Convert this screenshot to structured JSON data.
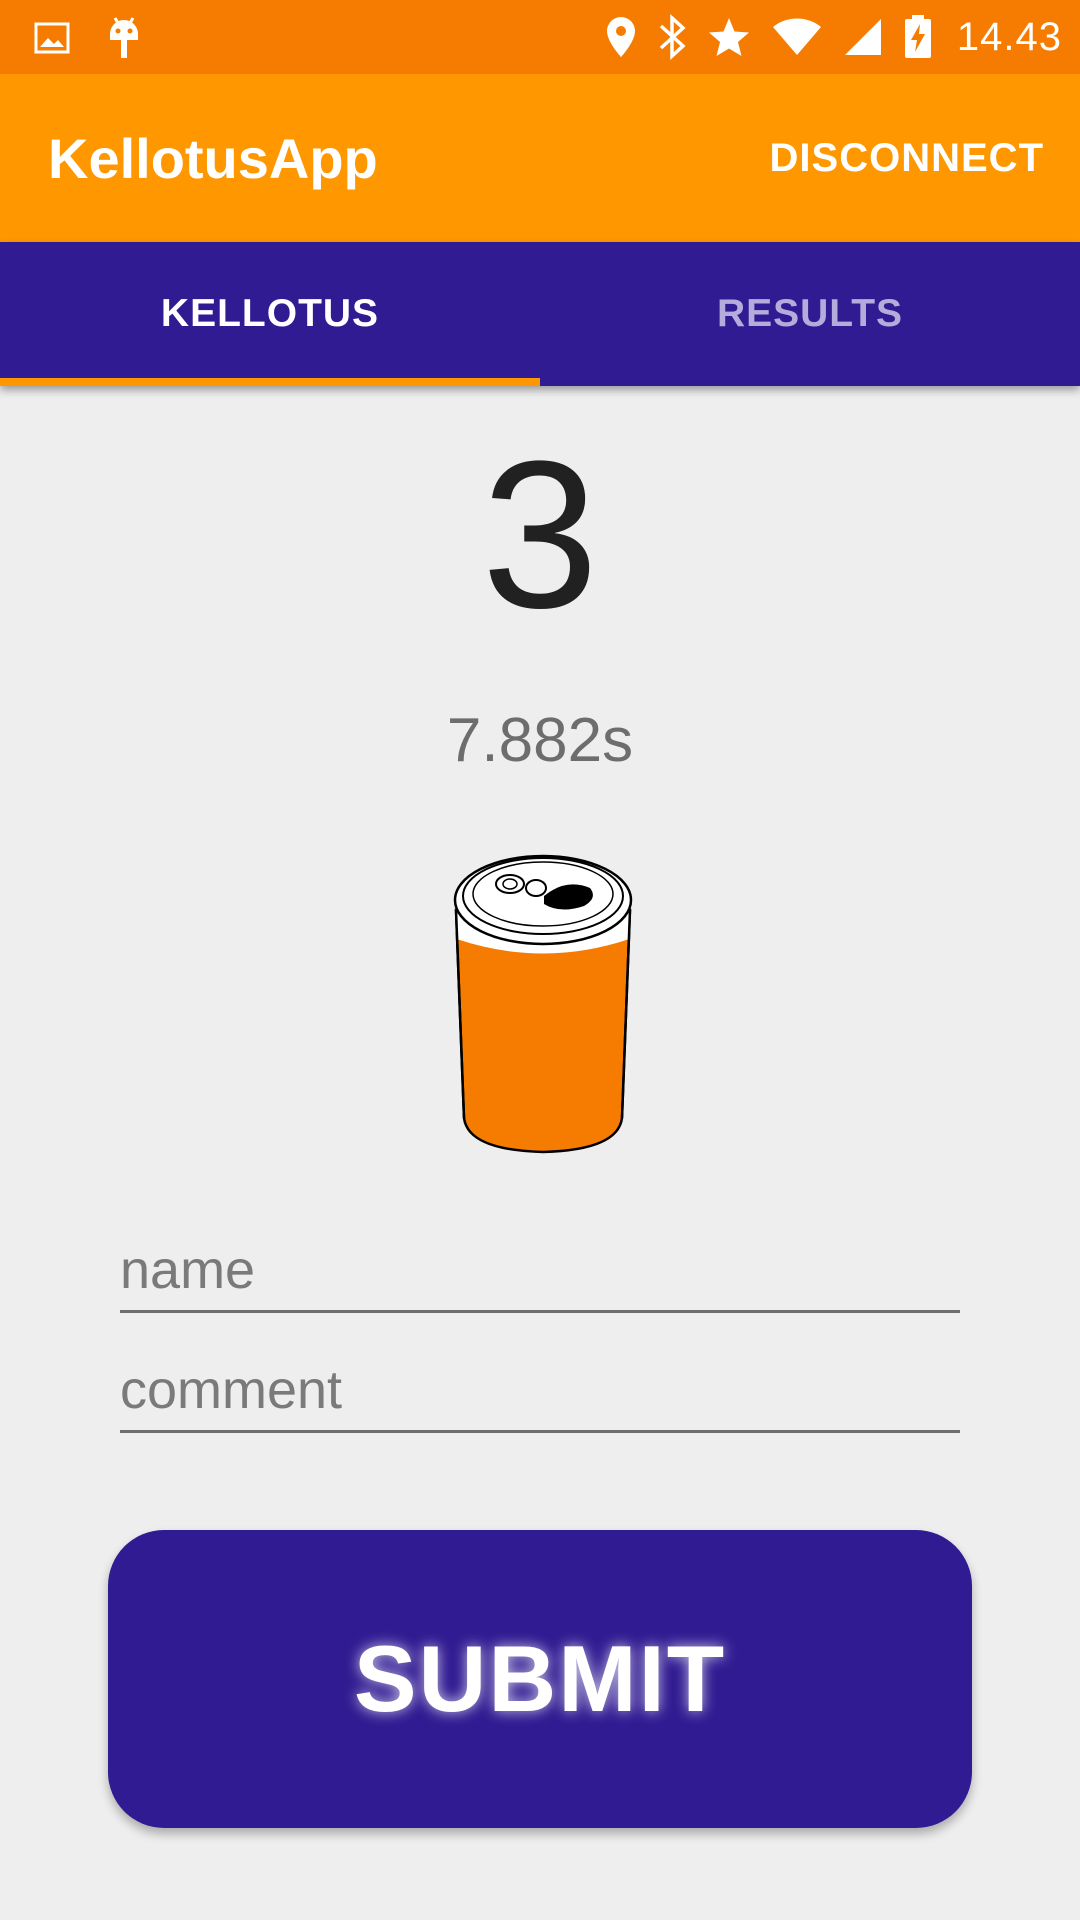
{
  "status_bar": {
    "time": "14.43",
    "icons": [
      "image-icon",
      "android-icon",
      "location-icon",
      "bluetooth-icon",
      "star-icon",
      "wifi-icon",
      "cell-signal-icon",
      "battery-charging-icon"
    ]
  },
  "app_bar": {
    "title": "KellotusApp",
    "action_label": "DISCONNECT"
  },
  "tabs": [
    {
      "label": "KELLOTUS",
      "active": true
    },
    {
      "label": "RESULTS",
      "active": false
    }
  ],
  "main": {
    "counter": "3",
    "timer": "7.882s",
    "name_placeholder": "name",
    "comment_placeholder": "comment",
    "submit_label": "SUBMIT"
  },
  "colors": {
    "status_bar": "#f57c00",
    "app_bar": "#ff9800",
    "tab_bar": "#311b92",
    "accent": "#ff9800",
    "button": "#311b92",
    "can": "#f57c00"
  }
}
